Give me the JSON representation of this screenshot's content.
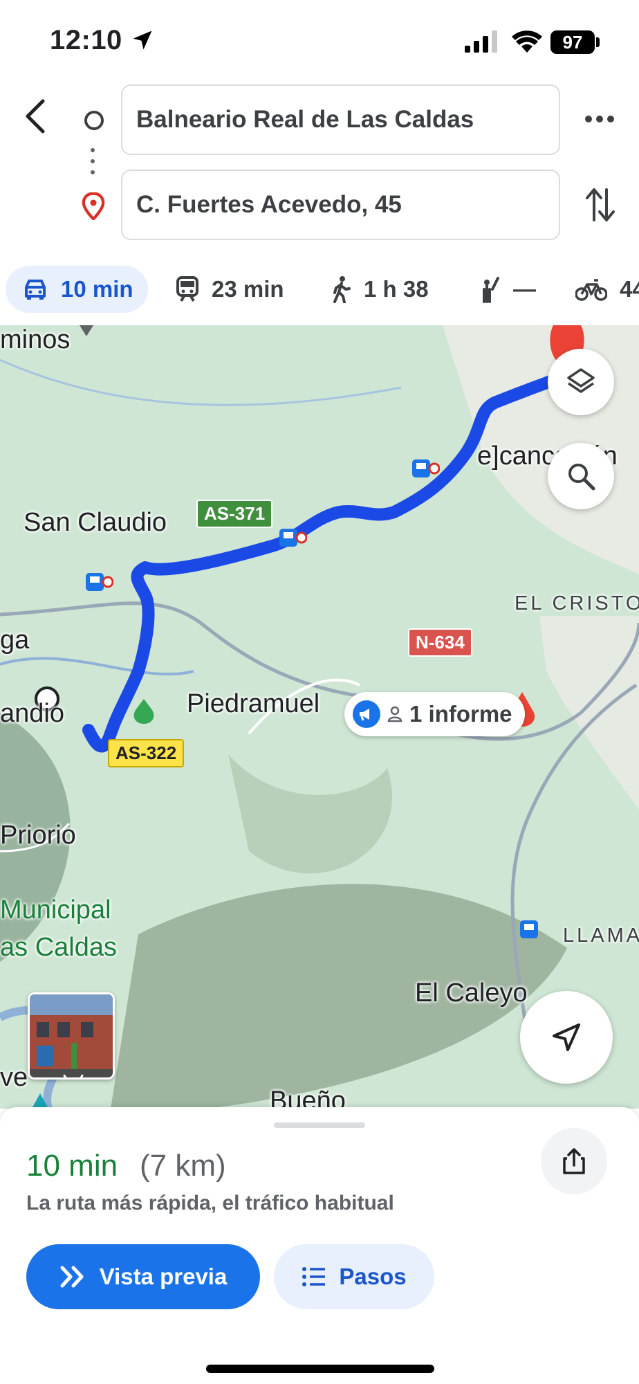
{
  "status_bar": {
    "time": "12:10",
    "battery": "97"
  },
  "route": {
    "origin": "Balneario Real de Las Caldas",
    "destination": "C. Fuertes Acevedo, 45"
  },
  "modes": [
    {
      "name": "car",
      "label": "10 min",
      "active": true
    },
    {
      "name": "transit",
      "label": "23 min"
    },
    {
      "name": "walk",
      "label": "1 h 38"
    },
    {
      "name": "ride",
      "label": "—"
    },
    {
      "name": "bike",
      "label": "44"
    }
  ],
  "map": {
    "labels": {
      "caminos": "minos",
      "san_claudio": "San Claudio",
      "ga": "ga",
      "andio": "andio",
      "piedramuelle": "Piedramuel",
      "priorio": "Priorio",
      "municipal": "Municipal",
      "las_caldas": "as Caldas",
      "el_caleyo": "El Caleyo",
      "bueno": "Bueño",
      "ve": "ve",
      "el_cristo": "EL CRISTO",
      "llamaquique": "LLAMAQ",
      "encarnacion": "e]cancación"
    },
    "roads": {
      "as371": "AS-371",
      "n634": "N-634",
      "as322": "AS-322"
    },
    "report": "1 informe",
    "route_color": "#1a49e6"
  },
  "sheet": {
    "duration": "10 min",
    "distance": "(7 km)",
    "summary": "La ruta más rápida, el tráfico habitual",
    "preview_label": "Vista previa",
    "steps_label": "Pasos"
  }
}
